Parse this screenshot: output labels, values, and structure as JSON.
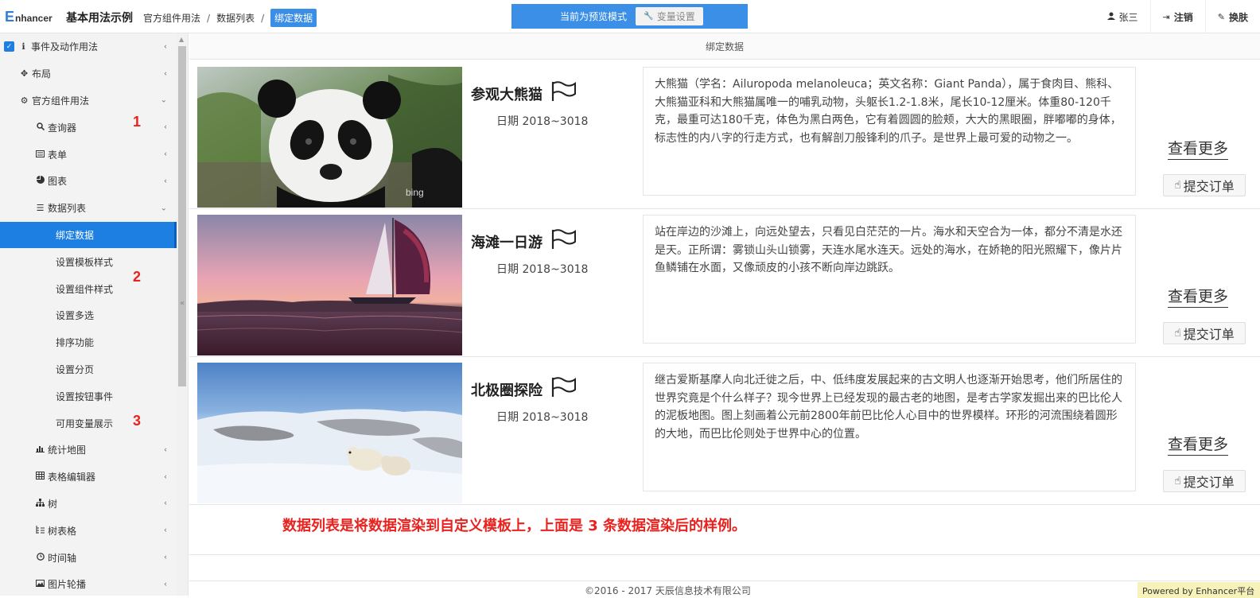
{
  "header": {
    "logo_e": "E",
    "logo_rest": "nhancer",
    "app_title": "基本用法示例",
    "breadcrumb": [
      "官方组件用法",
      "数据列表",
      "绑定数据"
    ],
    "breadcrumb_sep": "/",
    "preview_text": "当前为预览模式",
    "var_settings": "变量设置",
    "user": "张三",
    "logout": "注销",
    "skin": "换肤"
  },
  "sidebar": {
    "items": [
      {
        "label": "事件及动作用法",
        "icon": "info-icon"
      },
      {
        "label": "布局",
        "icon": "move-icon"
      },
      {
        "label": "官方组件用法",
        "icon": "puzzle-icon"
      },
      {
        "label": "查询器",
        "icon": "search-icon"
      },
      {
        "label": "表单",
        "icon": "form-icon"
      },
      {
        "label": "图表",
        "icon": "pie-icon"
      },
      {
        "label": "数据列表",
        "icon": "list-icon"
      },
      {
        "label": "绑定数据"
      },
      {
        "label": "设置模板样式"
      },
      {
        "label": "设置组件样式"
      },
      {
        "label": "设置多选"
      },
      {
        "label": "排序功能"
      },
      {
        "label": "设置分页"
      },
      {
        "label": "设置按钮事件"
      },
      {
        "label": "可用变量展示"
      },
      {
        "label": "统计地图",
        "icon": "bar-chart-icon"
      },
      {
        "label": "表格编辑器",
        "icon": "table-icon"
      },
      {
        "label": "树",
        "icon": "tree-icon"
      },
      {
        "label": "树表格",
        "icon": "tree-table-icon"
      },
      {
        "label": "时间轴",
        "icon": "clock-icon"
      },
      {
        "label": "图片轮播",
        "icon": "image-icon"
      }
    ]
  },
  "annotations": [
    "1",
    "2",
    "3"
  ],
  "content": {
    "title": "绑定数据",
    "rows": [
      {
        "title": "参观大熊猫",
        "date": "日期 2018~3018",
        "desc": "大熊猫（学名：Ailuropoda melanoleuca；英文名称：Giant Panda），属于食肉目、熊科、大熊猫亚科和大熊猫属唯一的哺乳动物，头躯长1.2-1.8米，尾长10-12厘米。体重80-120千克，最重可达180千克，体色为黑白两色，它有着圆圆的脸颊，大大的黑眼圈，胖嘟嘟的身体，标志性的内八字的行走方式，也有解剖刀般锋利的爪子。是世界上最可爱的动物之一。",
        "watermark": "bing"
      },
      {
        "title": "海滩一日游",
        "date": "日期 2018~3018",
        "desc": "站在岸边的沙滩上，向远处望去，只看见白茫茫的一片。海水和天空合为一体，都分不清是水还是天。正所谓：雾锁山头山锁雾，天连水尾水连天。远处的海水，在娇艳的阳光照耀下，像片片鱼鳞铺在水面，又像顽皮的小孩不断向岸边跳跃。"
      },
      {
        "title": "北极圈探险",
        "date": "日期 2018~3018",
        "desc": "继古爱斯基摩人向北迁徙之后，中、低纬度发展起来的古文明人也逐渐开始思考，他们所居住的世界究竟是个什么样子？现今世界上已经发现的最古老的地图，是考古学家发掘出来的巴比伦人的泥板地图。图上刻画着公元前2800年前巴比伦人心目中的世界模样。环形的河流围绕着圆形的大地，而巴比伦则处于世界中心的位置。"
      }
    ],
    "more_label": "查看更多",
    "order_label": "提交订单",
    "note": "数据列表是将数据渲染到自定义模板上，上面是 3 条数据渲染后的样例。",
    "copyright": "©2016 - 2017 天辰信息技术有限公司",
    "powered": "Powered by Enhancer平台"
  },
  "colors": {
    "accent": "#1e7fe3",
    "preview_bar": "#3b8fe6",
    "note_red": "#e8231f"
  }
}
